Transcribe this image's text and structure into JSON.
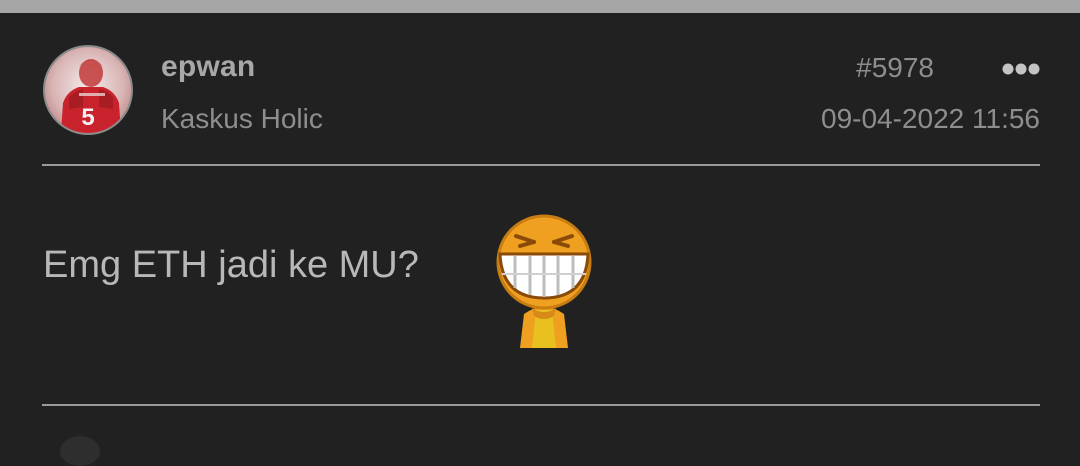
{
  "post": {
    "author": {
      "username": "epwan",
      "rank": "Kaskus Holic",
      "avatar_icon": "avatar-footballer-icon",
      "avatar_jersey_number": "5"
    },
    "post_number": "#5978",
    "timestamp": "09-04-2022 11:56",
    "more_icon": "more-options-icon",
    "message": "Emg ETH jadi ke MU?",
    "emoticon_icon": "laughing-emoticon-icon"
  },
  "colors": {
    "background": "#212121",
    "top_strip": "#a6a6a6",
    "divider": "#9a9a9a",
    "username": "#a8a8a8",
    "meta_text": "#8e8e8e",
    "message_text": "#b8b8b8",
    "emoticon_orange": "#f0a020",
    "emoticon_yellow": "#e8c020"
  }
}
